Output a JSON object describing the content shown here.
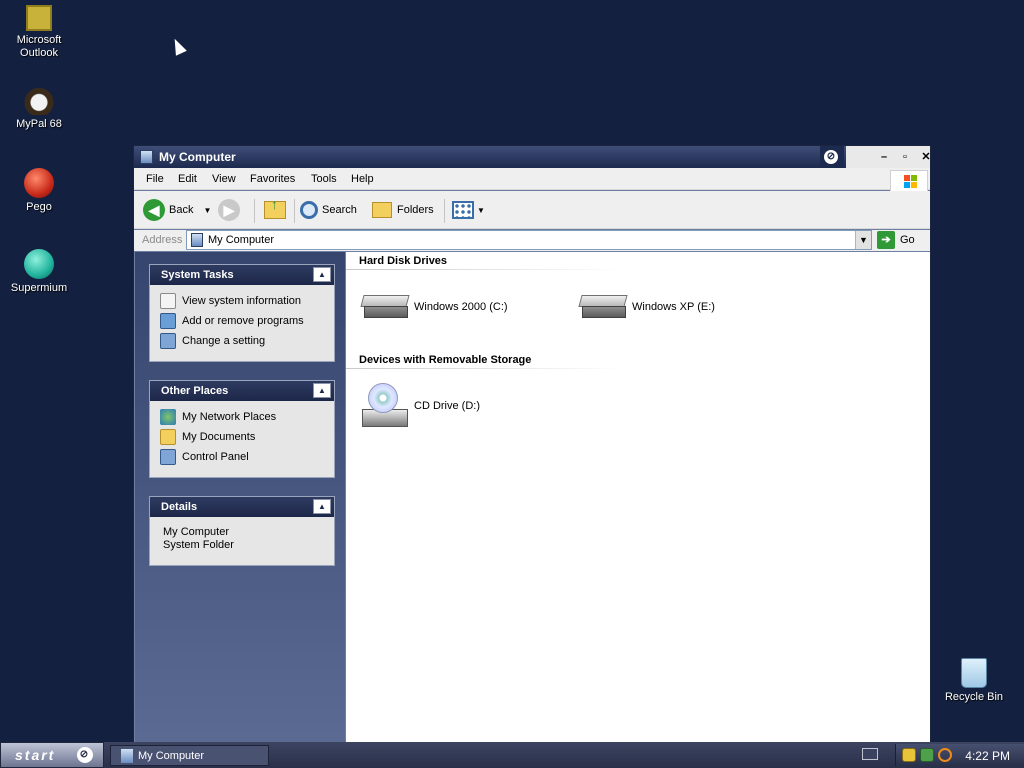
{
  "desktop": {
    "icons": [
      {
        "label": "Microsoft\nOutlook",
        "icon": "outlook-icon",
        "color": "#c9b23a"
      },
      {
        "label": "MyPal 68",
        "icon": "mypal-icon",
        "color": "#f2f2f2"
      },
      {
        "label": "Pego",
        "icon": "pego-icon",
        "color": "#c82a1a"
      },
      {
        "label": "Supermium",
        "icon": "supermium-icon",
        "color": "#1fb29c"
      },
      {
        "label": "Recycle Bin",
        "icon": "recycle-bin-icon",
        "color": "#9fc9e6"
      }
    ]
  },
  "window": {
    "title": "My Computer",
    "menu": [
      "File",
      "Edit",
      "View",
      "Favorites",
      "Tools",
      "Help"
    ],
    "toolbar": {
      "back": "Back",
      "search": "Search",
      "folders": "Folders"
    },
    "address": {
      "label": "Address",
      "value": "My Computer",
      "go": "Go"
    },
    "sidebar": {
      "system_tasks": {
        "title": "System Tasks",
        "items": [
          "View system information",
          "Add or remove programs",
          "Change a setting"
        ]
      },
      "other_places": {
        "title": "Other Places",
        "items": [
          "My Network Places",
          "My Documents",
          "Control Panel"
        ]
      },
      "details": {
        "title": "Details",
        "name": "My Computer",
        "type": "System Folder"
      }
    },
    "groups": {
      "hard_disks": {
        "title": "Hard Disk Drives",
        "items": [
          "Windows 2000 (C:)",
          "Windows XP (E:)"
        ]
      },
      "removable": {
        "title": "Devices with Removable Storage",
        "items": [
          "CD Drive (D:)"
        ]
      }
    }
  },
  "taskbar": {
    "start": "start",
    "task": "My Computer",
    "clock": "4:22 PM"
  }
}
